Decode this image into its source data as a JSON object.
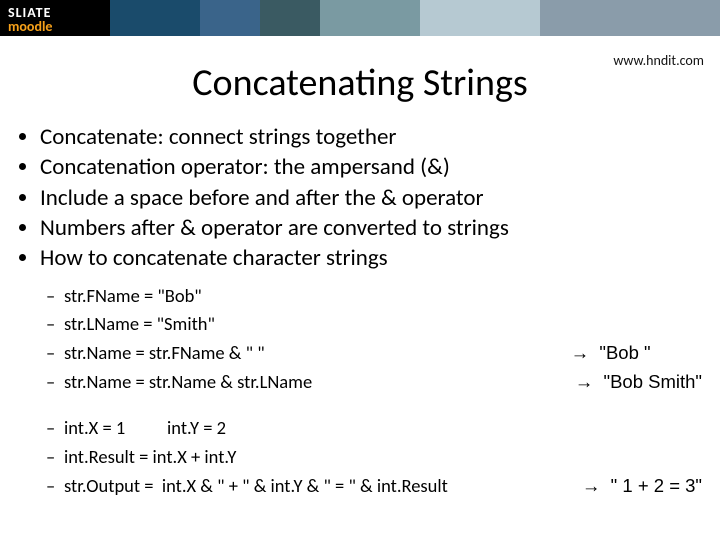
{
  "banner": {
    "line1": "SLIATE",
    "line2": "moodle"
  },
  "url": "www.hndit.com",
  "title": "Concatenating Strings",
  "bullets": [
    "Concatenate: connect strings together",
    "Concatenation operator: the ampersand (&)",
    "Include a space before and after the & operator",
    "Numbers after & operator are converted to strings",
    "How to concatenate character strings"
  ],
  "subA": [
    {
      "text": "str.FName = \"Bob\"",
      "result": ""
    },
    {
      "text": "str.LName = \"Smith\"",
      "result": ""
    },
    {
      "text": "str.Name = str.FName & \" \"",
      "result": "→  \"Bob \"          "
    },
    {
      "text": "str.Name = str.Name & str.LName",
      "result": "→  \"Bob Smith\""
    }
  ],
  "subB": [
    {
      "text": "int.X = 1          int.Y = 2",
      "result": ""
    },
    {
      "text": "int.Result = int.X + int.Y",
      "result": ""
    },
    {
      "text": "str.Output =  int.X & \" + \" & int.Y & \" = \" & int.Result",
      "result": "→  \" 1 + 2 = 3\""
    }
  ]
}
